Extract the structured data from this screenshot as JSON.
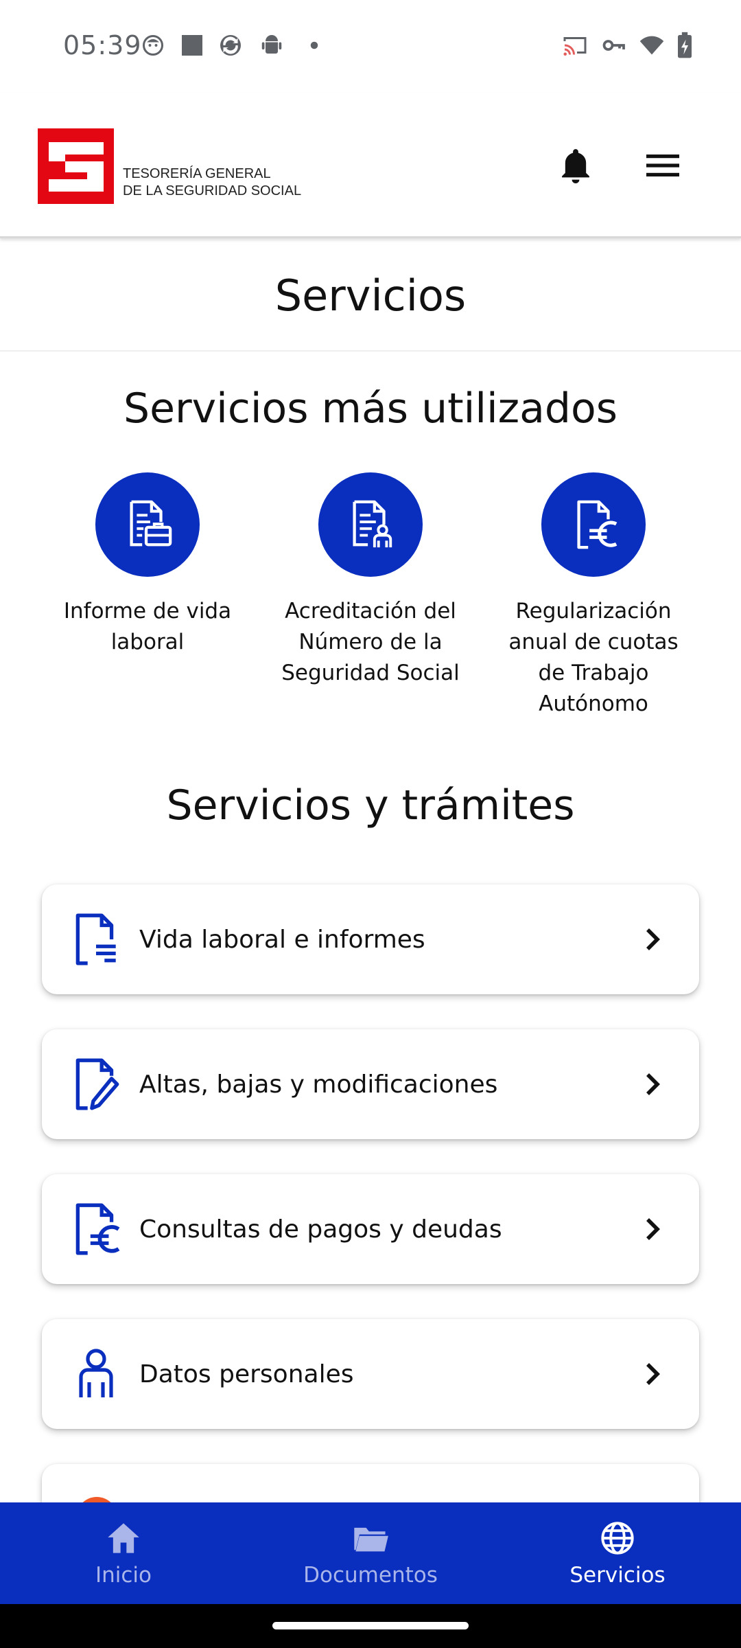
{
  "status_bar": {
    "time": "05:39",
    "left_icons": [
      "face-notification-icon",
      "square-notification-icon",
      "sync-app-icon",
      "android-icon",
      "dot-icon"
    ],
    "right_icons": [
      "cast-icon",
      "vpn-key-icon",
      "wifi-icon",
      "battery-charging-icon"
    ]
  },
  "header": {
    "logo_line1": "TESORERÍA GENERAL",
    "logo_line2": "DE LA SEGURIDAD SOCIAL",
    "brand_color": "#e30613"
  },
  "page": {
    "title": "Servicios"
  },
  "most_used": {
    "heading": "Servicios más utilizados",
    "items": [
      {
        "label": "Informe de vida laboral",
        "icon": "document-briefcase-icon"
      },
      {
        "label": "Acreditación del Número de la Seguridad Social",
        "icon": "document-person-icon"
      },
      {
        "label": "Regularización anual de cuotas de Trabajo Autónomo",
        "icon": "document-euro-icon"
      }
    ]
  },
  "procedures": {
    "heading": "Servicios y trámites",
    "items": [
      {
        "label": "Vida laboral e informes",
        "icon": "document-lines-icon"
      },
      {
        "label": "Altas, bajas y modificaciones",
        "icon": "document-pencil-icon"
      },
      {
        "label": "Consultas de pagos y deudas",
        "icon": "document-euro-icon"
      },
      {
        "label": "Datos personales",
        "icon": "person-icon"
      }
    ]
  },
  "bottom_nav": {
    "items": [
      {
        "label": "Inicio",
        "icon": "home-icon",
        "active": false
      },
      {
        "label": "Documentos",
        "icon": "folder-icon",
        "active": false
      },
      {
        "label": "Servicios",
        "icon": "globe-icon",
        "active": true
      }
    ]
  },
  "colors": {
    "primary": "#0a2ebd",
    "accent_red": "#e30613"
  }
}
